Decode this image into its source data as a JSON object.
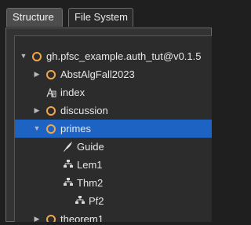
{
  "tabs": [
    {
      "label": "Structure",
      "active": true
    },
    {
      "label": "File System",
      "active": false
    }
  ],
  "tree": [
    {
      "label": "gh.pfsc_example.auth_tut@v0.1.5",
      "icon": "repo-circle-icon",
      "expanded": true
    },
    {
      "label": "AbstAlgFall2023",
      "icon": "module-circle-icon",
      "expanded": false
    },
    {
      "label": "index",
      "icon": "index-icon"
    },
    {
      "label": "discussion",
      "icon": "module-circle-icon",
      "expanded": false
    },
    {
      "label": "primes",
      "icon": "module-circle-icon",
      "expanded": true,
      "selected": true
    },
    {
      "label": "Guide",
      "icon": "quill-pen-icon"
    },
    {
      "label": "Lem1",
      "icon": "deduction-tree-icon"
    },
    {
      "label": "Thm2",
      "icon": "deduction-tree-icon"
    },
    {
      "label": "Pf2",
      "icon": "deduction-tree-icon"
    },
    {
      "label": "theorem1",
      "icon": "module-circle-icon",
      "expanded": false
    }
  ],
  "colors": {
    "accent": "#f0a64a",
    "selection": "#1d63c3",
    "background": "#1f1f1f"
  }
}
